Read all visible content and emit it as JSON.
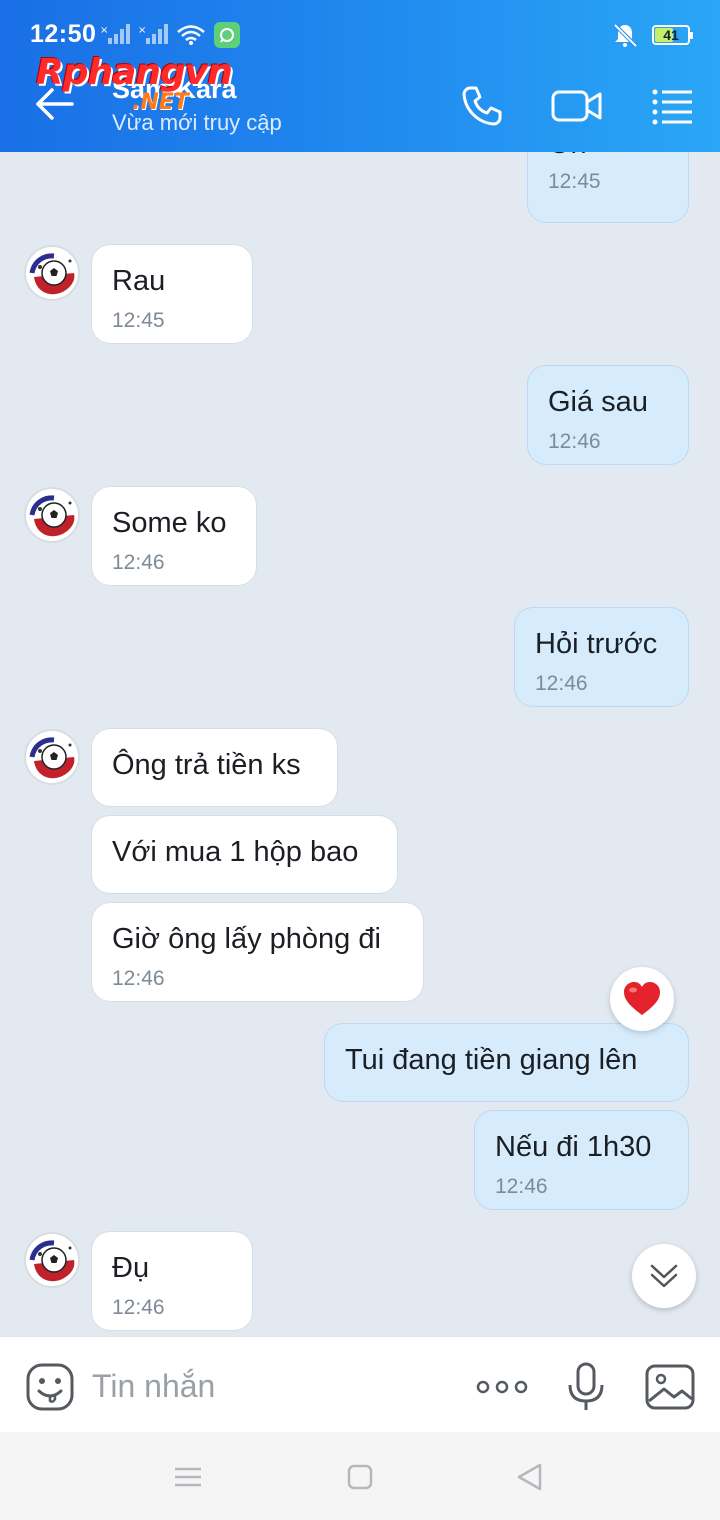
{
  "status_bar": {
    "time": "12:50",
    "battery": "41"
  },
  "header": {
    "contact_name": "Sam Kara",
    "contact_status": "Vừa mới truy cập",
    "watermark_main": "Rphangvn",
    "watermark_sub": ".NET"
  },
  "messages": [
    {
      "side": "out",
      "text": "Oh",
      "time": "12:45"
    },
    {
      "side": "in",
      "text": "Rau",
      "time": "12:45"
    },
    {
      "side": "out",
      "text": "Giá sau",
      "time": "12:46"
    },
    {
      "side": "in",
      "text": "Some ko",
      "time": "12:46"
    },
    {
      "side": "out",
      "text": "Hỏi trước",
      "time": "12:46"
    },
    {
      "side": "in",
      "text": "Ông trả tiền ks",
      "time": ""
    },
    {
      "side": "in",
      "text": "Với mua 1 hộp bao",
      "time": ""
    },
    {
      "side": "in",
      "text": "Giờ ông lấy phòng đi",
      "time": "12:46"
    },
    {
      "side": "out",
      "text": "Tui đang tiền giang lên",
      "time": "",
      "reaction": "heart"
    },
    {
      "side": "out",
      "text": "Nếu đi 1h30",
      "time": "12:46"
    },
    {
      "side": "in",
      "text": "Đụ",
      "time": "12:46"
    }
  ],
  "input": {
    "placeholder": "Tin nhắn"
  },
  "colors": {
    "header_gradient_start": "#1a6fe6",
    "header_gradient_end": "#2aa6f6",
    "outgoing_bubble": "#d6ecfd",
    "incoming_bubble": "#ffffff",
    "chat_background": "#e2e9f1",
    "reaction_heart": "#e3222b"
  },
  "icons": {
    "back": "arrow-left-icon",
    "call": "phone-icon",
    "video": "video-camera-icon",
    "menu": "list-menu-icon",
    "emoji": "emoji-sticker-icon",
    "more": "more-dots-icon",
    "mic": "microphone-icon",
    "image": "image-gallery-icon",
    "scroll": "double-chevron-down-icon",
    "reaction": "heart-icon"
  }
}
